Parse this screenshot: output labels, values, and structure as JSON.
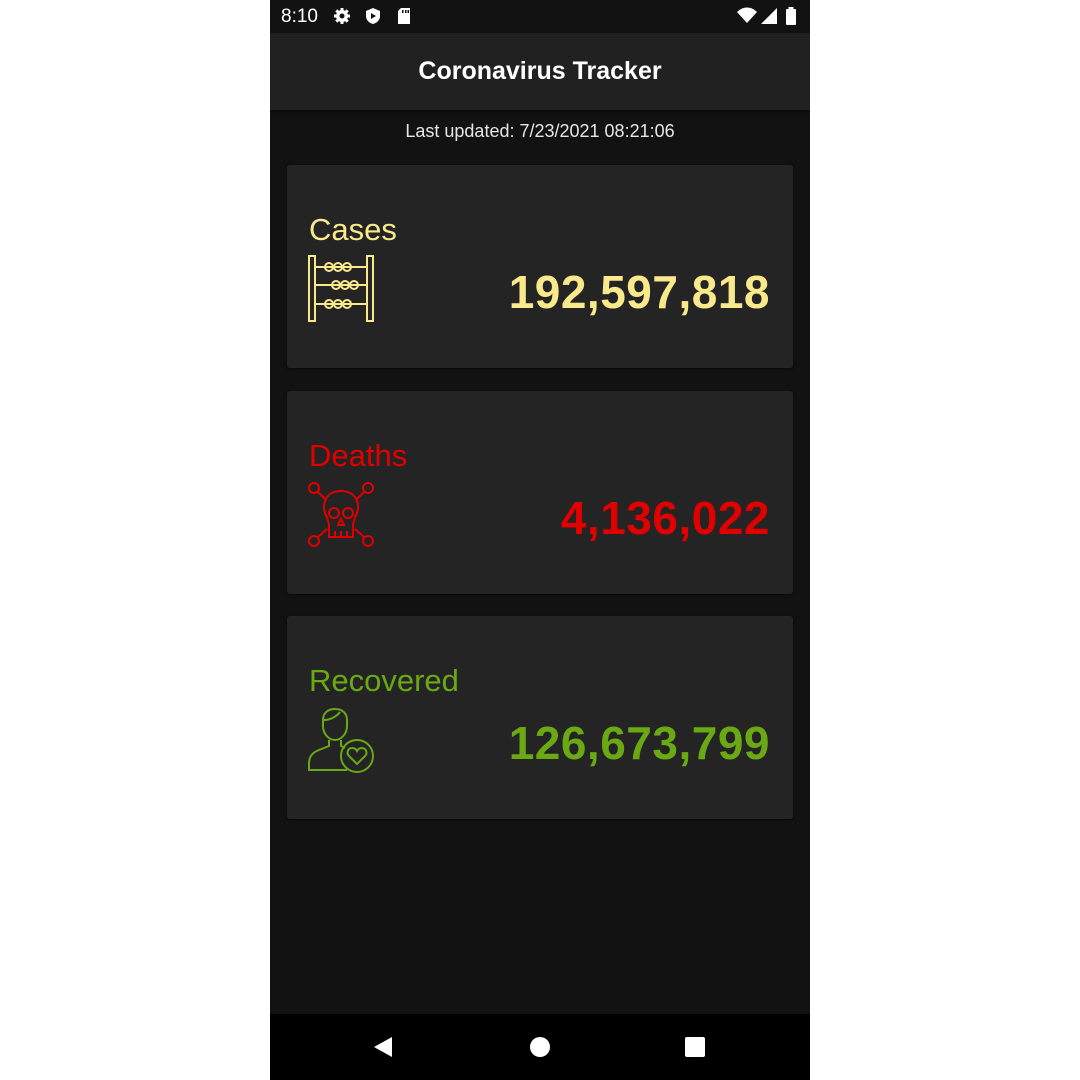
{
  "status_bar": {
    "time": "8:10",
    "icons": [
      "gear-icon",
      "shield-play-icon",
      "sd-card-icon",
      "wifi-icon",
      "signal-icon",
      "battery-icon"
    ]
  },
  "app_bar": {
    "title": "Coronavirus Tracker"
  },
  "last_updated": "Last updated: 7/23/2021 08:21:06",
  "cards": [
    {
      "label": "Cases",
      "value": "192,597,818",
      "icon": "abacus-icon",
      "color": "#f9e98b"
    },
    {
      "label": "Deaths",
      "value": "4,136,022",
      "icon": "skull-crossbones-icon",
      "color": "#e00000"
    },
    {
      "label": "Recovered",
      "value": "126,673,799",
      "icon": "person-heart-icon",
      "color": "#6aa814"
    }
  ],
  "nav_bar": {
    "buttons": [
      "back-icon",
      "home-icon",
      "recents-icon"
    ]
  }
}
